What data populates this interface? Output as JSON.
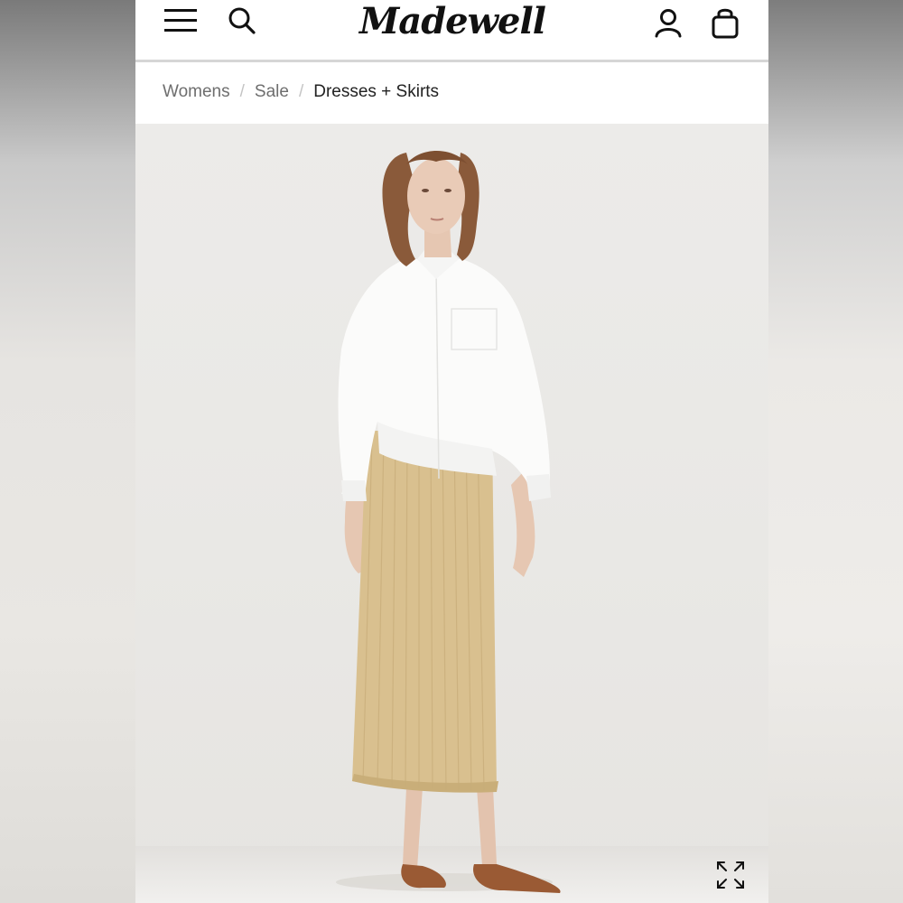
{
  "header": {
    "brand": "Madewell",
    "icons": {
      "menu": "hamburger-menu-icon",
      "search": "search-icon",
      "account": "account-icon",
      "bag": "shopping-bag-icon"
    }
  },
  "breadcrumb": {
    "items": [
      "Womens",
      "Sale",
      "Dresses + Skirts"
    ],
    "separator": "/"
  },
  "product_image": {
    "expand_icon": "expand-icon"
  },
  "colors": {
    "text_primary": "#111111",
    "text_muted": "#6e6e6e",
    "skirt": "#d9c08f",
    "shirt": "#fbfbfa"
  }
}
